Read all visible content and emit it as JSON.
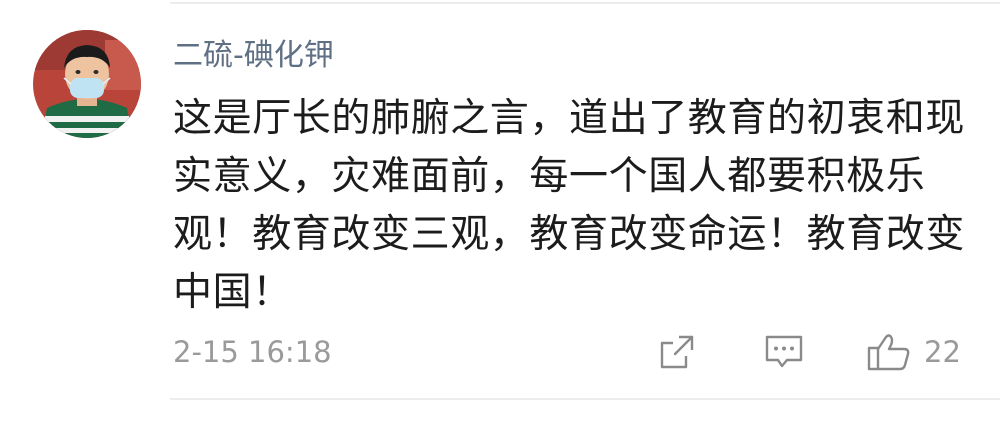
{
  "comment": {
    "username": "二硫-碘化钾",
    "text": "这是厅长的肺腑之言，道出了教育的初衷和现实意义，灾难面前，每一个国人都要积极乐观！教育改变三观，教育改变命运！教育改变中国！",
    "timestamp": "2-15 16:18"
  },
  "actions": {
    "share_icon": "share-icon",
    "comment_icon": "comment-icon",
    "like_icon": "thumbs-up-icon",
    "like_count": "22"
  },
  "colors": {
    "username": "#5f6f84",
    "text": "#1c1c1c",
    "meta": "#9a9a9a",
    "divider": "#ededed"
  }
}
